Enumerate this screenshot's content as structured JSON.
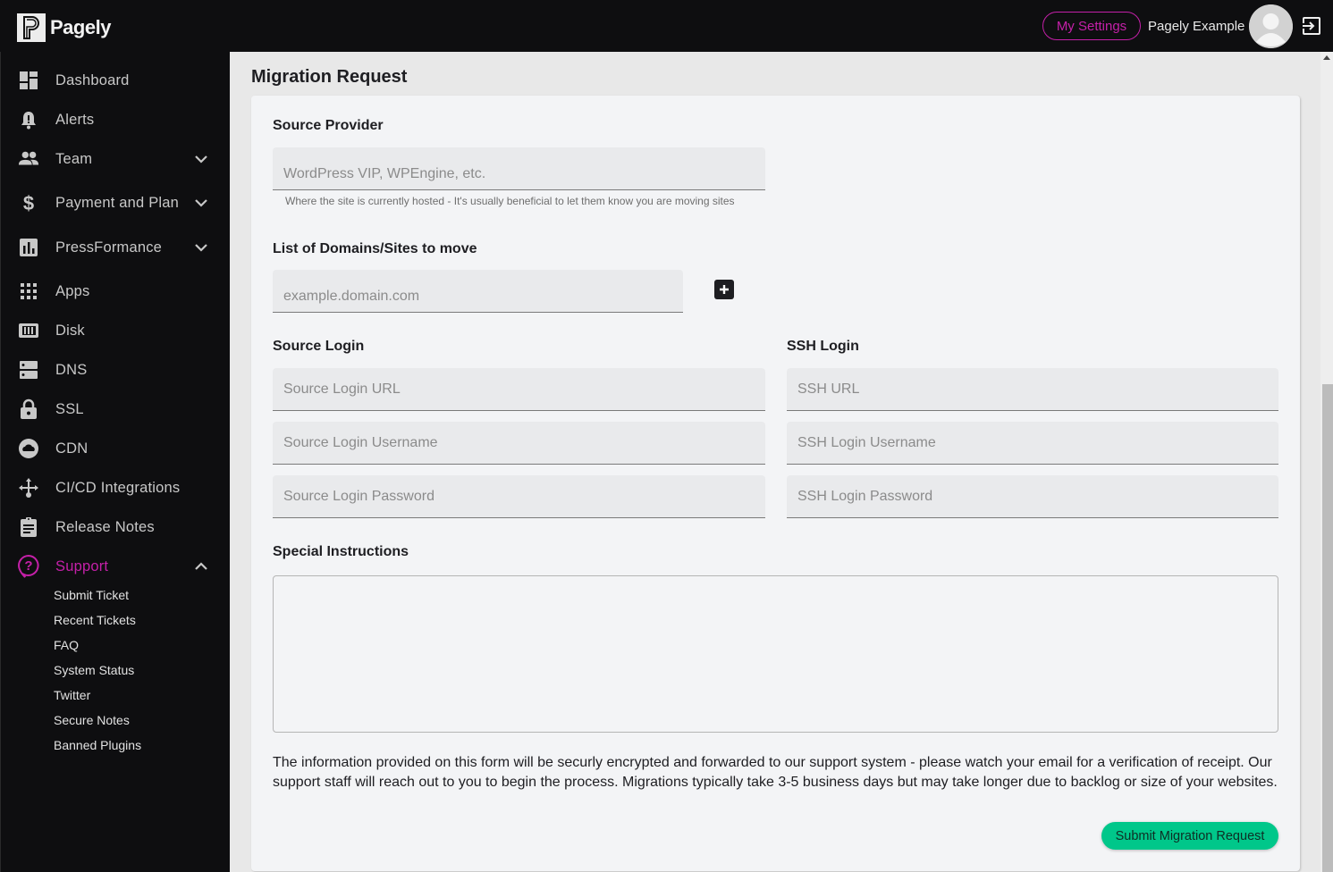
{
  "header": {
    "brand": "Pagely",
    "my_settings_label": "My Settings",
    "user_name": "Pagely Example",
    "accent_color": "#c420a8"
  },
  "sidebar": {
    "items": [
      {
        "label": "Dashboard",
        "icon": "dashboard-icon"
      },
      {
        "label": "Alerts",
        "icon": "bell-icon"
      },
      {
        "label": "Team",
        "icon": "team-icon",
        "expandable": true
      },
      {
        "label": "Payment and Plan",
        "icon": "dollar-icon",
        "expandable": true
      },
      {
        "label": "PressFormance",
        "icon": "bar-chart-icon",
        "expandable": true
      },
      {
        "label": "Apps",
        "icon": "apps-grid-icon"
      },
      {
        "label": "Disk",
        "icon": "disk-icon"
      },
      {
        "label": "DNS",
        "icon": "dns-icon"
      },
      {
        "label": "SSL",
        "icon": "lock-icon"
      },
      {
        "label": "CDN",
        "icon": "cloud-icon"
      },
      {
        "label": "CI/CD Integrations",
        "icon": "branch-icon"
      },
      {
        "label": "Release Notes",
        "icon": "clipboard-icon"
      },
      {
        "label": "Support",
        "icon": "help-icon",
        "expandable": true,
        "expanded": true,
        "active": true
      }
    ],
    "support_subitems": [
      "Submit Ticket",
      "Recent Tickets",
      "FAQ",
      "System Status",
      "Twitter",
      "Secure Notes",
      "Banned Plugins"
    ]
  },
  "page": {
    "title": "Migration Request",
    "source_provider": {
      "label": "Source Provider",
      "placeholder": "WordPress VIP, WPEngine, etc.",
      "value": "",
      "helper": "Where the site is currently hosted - It's usually beneficial to let them know you are moving sites"
    },
    "domains": {
      "label": "List of Domains/Sites to move",
      "placeholder": "example.domain.com",
      "value": ""
    },
    "source_login": {
      "label": "Source Login",
      "url_placeholder": "Source Login URL",
      "username_placeholder": "Source Login Username",
      "password_placeholder": "Source Login Password"
    },
    "ssh_login": {
      "label": "SSH Login",
      "url_placeholder": "SSH URL",
      "username_placeholder": "SSH Login Username",
      "password_placeholder": "SSH Login Password"
    },
    "special_instructions": {
      "label": "Special Instructions",
      "value": ""
    },
    "info_text": "The information provided on this form will be securly encrypted and forwarded to our support system - please watch your email for a verification of receipt. Our support staff will reach out to you to begin the process. Migrations typically take 3-5 business days but may take longer due to backlog or size of your websites.",
    "submit_label": "Submit Migration Request",
    "submit_color": "#00c78a"
  }
}
